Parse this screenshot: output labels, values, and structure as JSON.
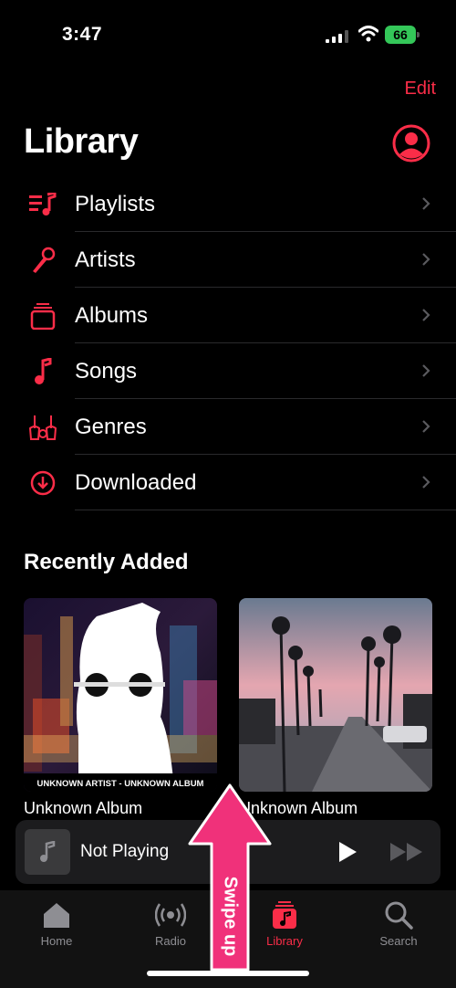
{
  "status": {
    "time": "3:47",
    "battery": "66"
  },
  "header": {
    "edit_label": "Edit",
    "title": "Library"
  },
  "library_items": [
    {
      "label": "Playlists",
      "icon": "playlist-icon"
    },
    {
      "label": "Artists",
      "icon": "microphone-icon"
    },
    {
      "label": "Albums",
      "icon": "album-stack-icon"
    },
    {
      "label": "Songs",
      "icon": "music-note-icon"
    },
    {
      "label": "Genres",
      "icon": "guitars-icon"
    },
    {
      "label": "Downloaded",
      "icon": "download-circle-icon"
    }
  ],
  "recent": {
    "title": "Recently Added",
    "albums": [
      {
        "label": "Unknown Album",
        "cover_caption": "UNKNOWN ARTIST - UNKNOWN ALBUM"
      },
      {
        "label": "Unknown Album"
      }
    ]
  },
  "mini_player": {
    "title": "Not Playing"
  },
  "tabs": [
    {
      "label": "Home",
      "icon": "home-icon"
    },
    {
      "label": "Radio",
      "icon": "radio-icon"
    },
    {
      "label": "Library",
      "icon": "library-icon",
      "active": true
    },
    {
      "label": "Search",
      "icon": "search-icon"
    }
  ],
  "annotation": {
    "text": "Swipe up"
  },
  "colors": {
    "accent": "#fa2d48",
    "annotation": "#f0317a",
    "battery": "#34c759"
  }
}
